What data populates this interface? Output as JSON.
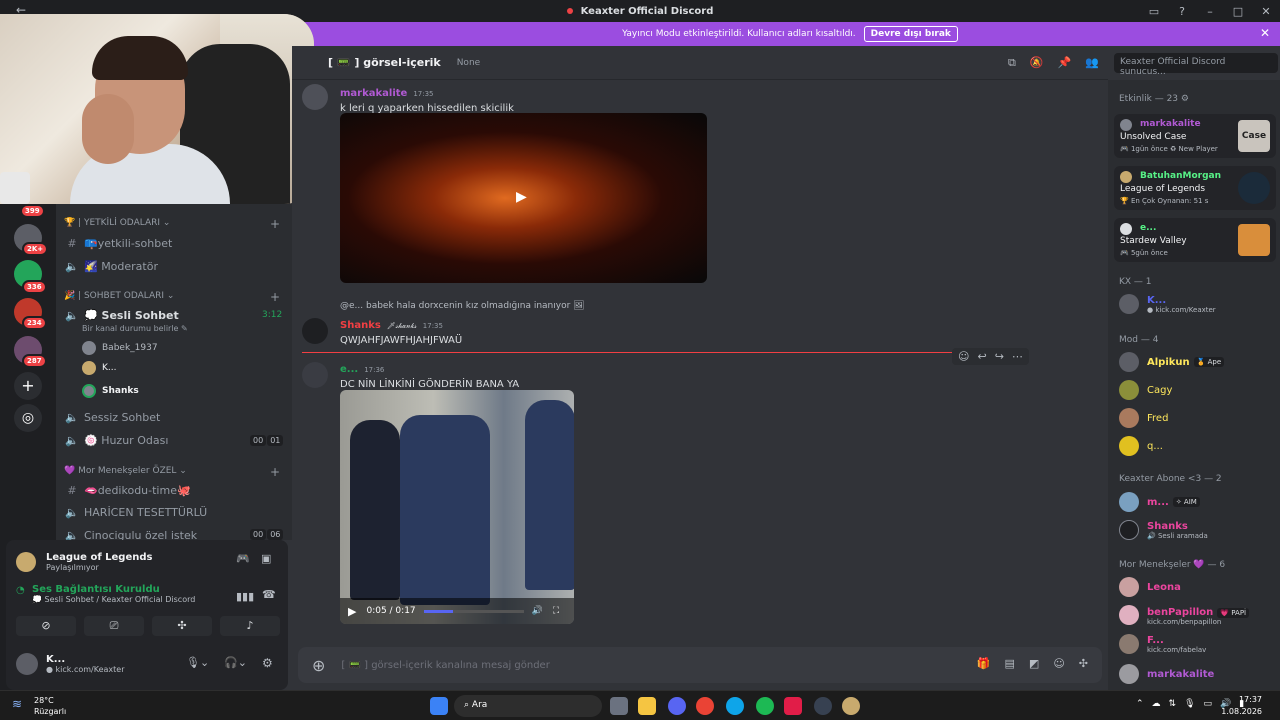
{
  "window": {
    "title": "Keaxter Official Discord",
    "back": "←"
  },
  "banner": {
    "text": "Yayıncı Modu etkinleştirildi. Kullanıcı adları kısaltıldı.",
    "button": "Devre dışı bırak",
    "close": "✕"
  },
  "servers": {
    "badges": [
      "399",
      "2K+",
      "336",
      "234",
      "287"
    ],
    "add": "+",
    "discover": "◎"
  },
  "channels": {
    "cat1": "🏆 | YETKİLİ ODALARI ⌄",
    "yetkili": "📪yetkili-sohbet",
    "moderator": "🌠 Moderatör",
    "cat2": "🎉 | SOHBET ODALARI ⌄",
    "sesli": "💭 Sesli Sohbet",
    "sesli_time": "3:12",
    "sesli_status": "Bir kanal durumu belirle ✎",
    "vu1": "Babek_1937",
    "vu2": "K...",
    "vu3": "Shanks",
    "sessiz": "Sessiz Sohbet",
    "huzur": "🍥 Huzur Odası",
    "huzur_a": "00",
    "huzur_b": "01",
    "cat3": "💜 Mor Menekşeler ÖZEL ⌄",
    "dedikodu": "🫦dedikodu-time🐙",
    "haricen": "HARİCEN TESETTÜRLÜ",
    "cinoci": "Cinocigulu özel istek",
    "cinoci_a": "00",
    "cinoci_b": "06"
  },
  "game": {
    "title": "League of Legends",
    "sub": "Paylaşılmıyor"
  },
  "voice": {
    "title": "Ses Bağlantısı Kuruldu",
    "sub": "💭 Sesli Sohbet / Keaxter Official Discord"
  },
  "user": {
    "name": "K...",
    "status": "● kick.com/Keaxter"
  },
  "chat": {
    "channel": "[ 📟 ] görsel-içerik",
    "topic": "None",
    "search": "Keaxter Official Discord sunucus...",
    "m1_author": "markakalite",
    "m1_time": "17:35",
    "m1_text": "k leri q yaparken hissedilen skicilik",
    "reply_text": "@e... babek hala dorxcenin kız olmadığına inanıyor 🖼",
    "m2_author": "Shanks",
    "m2_tag": "🗡︎𝓈𝒽𝒶𝓃𝓀𝓈",
    "m2_time": "17:35",
    "m2_text": "QWJAHFJAWFHJAHJFWAÜ",
    "m3_author": "e...",
    "m3_time": "17:36",
    "m3_text": "DC NİN LİNKİNİ GÖNDERİN BANA YA",
    "video_time": "0:05 / 0:17",
    "video_progress": 0.29,
    "placeholder": "[ 📟 ] görsel-içerik kanalına mesaj gönder"
  },
  "members": {
    "activity_title": "Etkinlik — 23 ⚙",
    "a1_name": "markakalite",
    "a1_game": "Unsolved Case",
    "a1_sub": "🎮 1gün önce  ♻ New Player",
    "a1_thumb": "Case",
    "a2_name": "BatuhanMorgan",
    "a2_game": "League of Legends",
    "a2_sub": "🏆 En Çok Oynanan: 51 s",
    "a3_name": "e...",
    "a3_game": "Stardew Valley",
    "a3_sub": "🎮 5gün önce",
    "kx": "KX — 1",
    "kx1": "K...",
    "kx1_sub": "● kick.com/Keaxter",
    "mod": "Mod — 4",
    "mod1": "Alpikun",
    "mod1_tag": "🏅 Ape",
    "mod2": "Cagy",
    "mod3": "Fred",
    "mod4": "q...",
    "abone": "Keaxter Abone <3 — 2",
    "ab1": "m...",
    "ab1_tag": "✧ AIM",
    "ab2": "Shanks",
    "ab2_sub": "🔊 Sesli aramada",
    "mor": "Mor Menekşeler 💜 — 6",
    "mm1": "Leona",
    "mm2": "benPapillon",
    "mm2_tag": "💗 PAPİ",
    "mm2_sub": "kick.com/benpapillon",
    "mm3": "F...",
    "mm3_sub": "kick.com/fabelav",
    "mm4": "markakalite"
  },
  "taskbar": {
    "temp": "28°C",
    "weather": "Rüzgarlı",
    "search": "Ara",
    "time": "17:37",
    "date": "1.08.2026"
  }
}
